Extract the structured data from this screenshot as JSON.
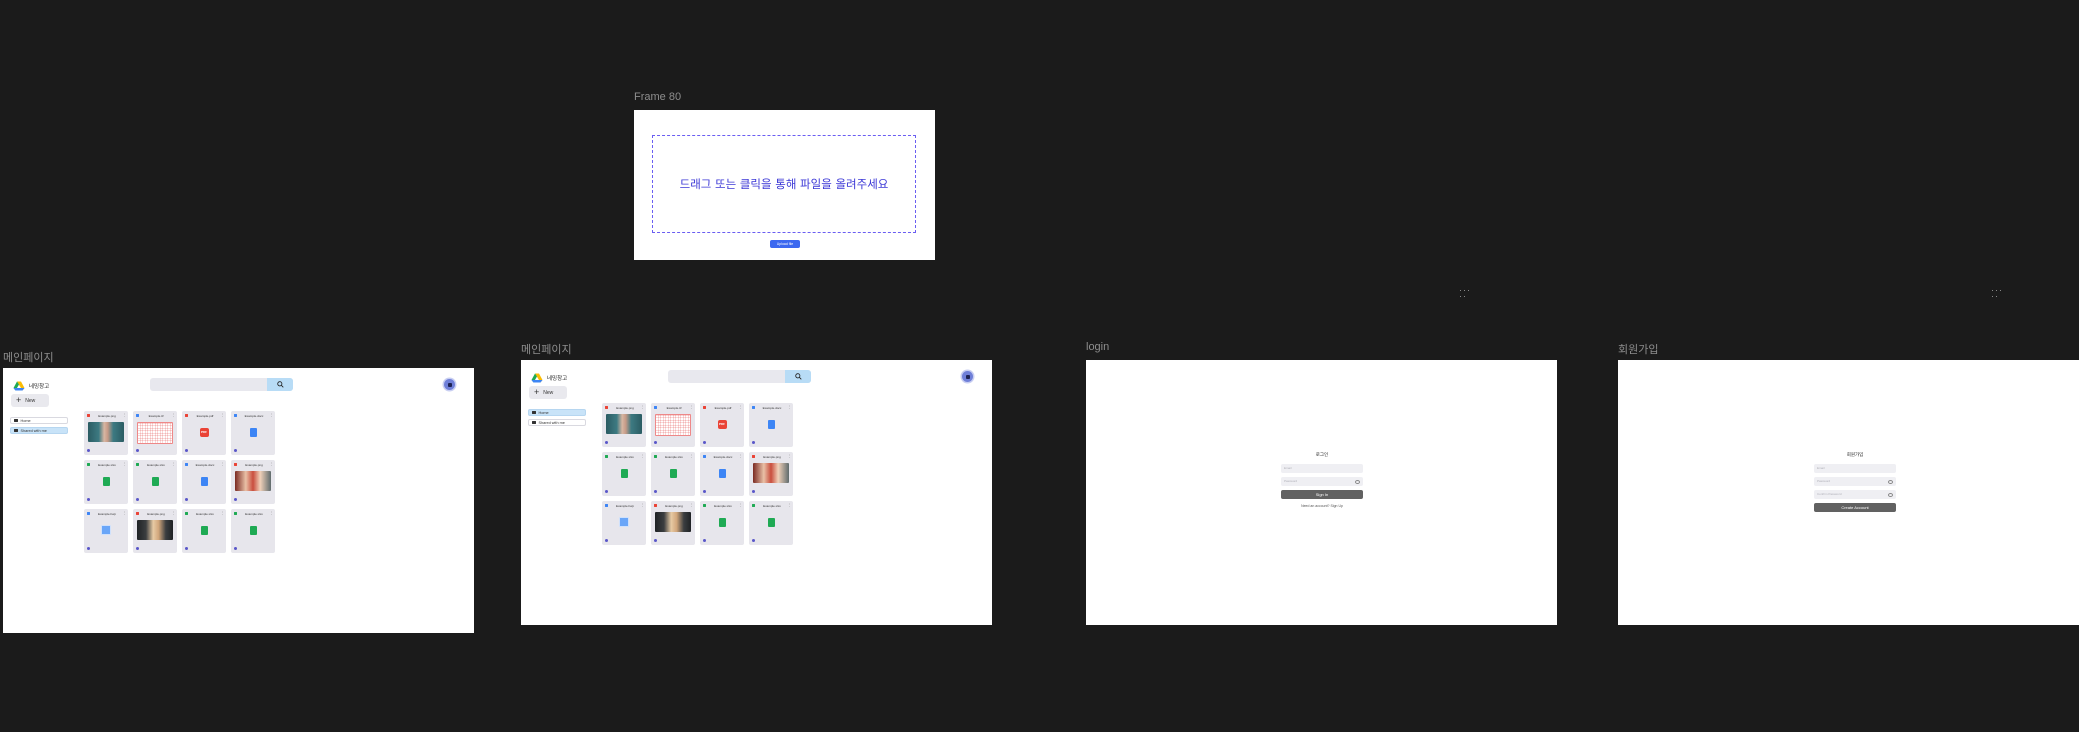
{
  "frames": {
    "upload": {
      "label": "Frame 80",
      "drop_text": "드래그 또는 클릭을 통해 파일을 올려주세요",
      "button": "Upload file"
    },
    "main1": {
      "label": "메인페이지"
    },
    "main2": {
      "label": "메인페이지"
    },
    "login": {
      "label": "login"
    },
    "signup": {
      "label": "회원가입"
    }
  },
  "app": {
    "logo_text": "네밍창고",
    "new_label": "New",
    "nav": [
      "Home",
      "Shared with me"
    ],
    "search_icon": "search-icon",
    "avatar_icon": "user-avatar-icon",
    "files": [
      {
        "name": "Example.png",
        "type": "image",
        "thumb": "photo-a",
        "color": "#ea4336"
      },
      {
        "name": "Example.tif",
        "type": "image",
        "thumb": "photo-b",
        "color": "#3d85f5"
      },
      {
        "name": "Example.pdf",
        "type": "pdf",
        "thumb": "pdf",
        "color": "#ea4336"
      },
      {
        "name": "Example.docx",
        "type": "doc",
        "thumb": "doc",
        "color": "#3d85f5"
      },
      {
        "name": "Example.xlsx",
        "type": "sheet",
        "thumb": "sheet",
        "color": "#1faa54"
      },
      {
        "name": "Example.xlsx",
        "type": "sheet",
        "thumb": "sheet",
        "color": "#1faa54"
      },
      {
        "name": "Example.docx",
        "type": "doc",
        "thumb": "doc",
        "color": "#3d85f5"
      },
      {
        "name": "Example.png",
        "type": "image",
        "thumb": "photo-c",
        "color": "#ea4336"
      },
      {
        "name": "Example.hwp",
        "type": "slide",
        "thumb": "slide",
        "color": "#3d85f5"
      },
      {
        "name": "Example.png",
        "type": "image",
        "thumb": "photo-d",
        "color": "#ea4336"
      },
      {
        "name": "Example.xlsx",
        "type": "sheet",
        "thumb": "sheet",
        "color": "#1faa54"
      },
      {
        "name": "Example.xlsx",
        "type": "sheet",
        "thumb": "sheet",
        "color": "#1faa54"
      }
    ]
  },
  "login": {
    "title": "로그인",
    "email_placeholder": "Email",
    "password_placeholder": "Password",
    "button": "Sign In",
    "footer": "Need an account? Sign Up"
  },
  "signup": {
    "title": "회원가입",
    "email_placeholder": "Email",
    "password_placeholder": "Password",
    "confirm_placeholder": "Confirm Password",
    "button": "Create Account"
  }
}
